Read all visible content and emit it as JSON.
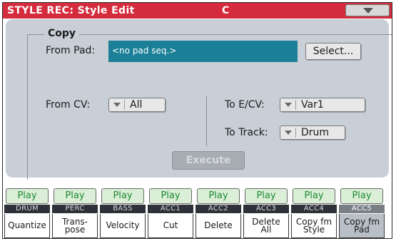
{
  "header": {
    "title": "STYLE REC: Style Edit",
    "key": "C",
    "menu_icon": "chevron-down-icon"
  },
  "copy": {
    "legend": "Copy",
    "from_pad_label": "From Pad:",
    "from_pad_value": "<no pad seq.>",
    "select_button": "Select...",
    "from_cv_label": "From CV:",
    "from_cv_value": "All",
    "to_ecv_label": "To E/CV:",
    "to_ecv_value": "Var1",
    "to_track_label": "To Track:",
    "to_track_value": "Drum",
    "execute_button": "Execute"
  },
  "tracks": [
    {
      "status": "Play",
      "name": "DRUM"
    },
    {
      "status": "Play",
      "name": "PERC"
    },
    {
      "status": "Play",
      "name": "BASS"
    },
    {
      "status": "Play",
      "name": "ACC1"
    },
    {
      "status": "Play",
      "name": "ACC2"
    },
    {
      "status": "Play",
      "name": "ACC3"
    },
    {
      "status": "Play",
      "name": "ACC4"
    },
    {
      "status": "Play",
      "name": "ACC5"
    }
  ],
  "tabs": [
    {
      "label": "Quantize"
    },
    {
      "label": "Trans-\npose"
    },
    {
      "label": "Velocity"
    },
    {
      "label": "Cut"
    },
    {
      "label": "Delete"
    },
    {
      "label": "Delete\nAll"
    },
    {
      "label": "Copy fm\nStyle"
    },
    {
      "label": "Copy fm\nPad"
    }
  ],
  "colors": {
    "header": "#d42c3c",
    "panel": "#c8cfd6",
    "pad_field": "#1a7f97",
    "play_text": "#1d8a2e"
  }
}
